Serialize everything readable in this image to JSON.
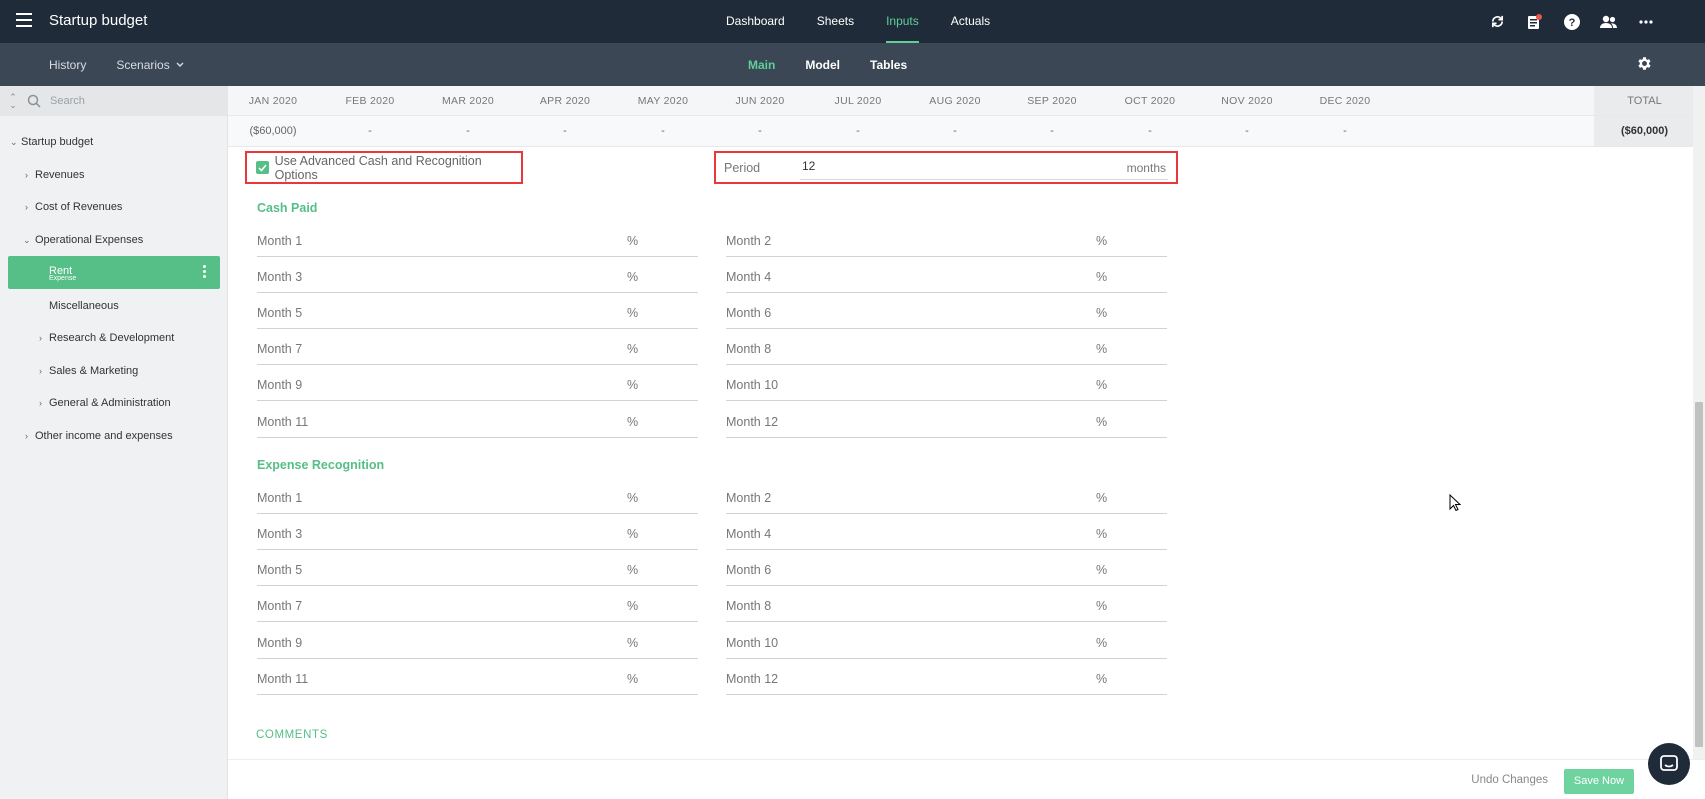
{
  "app": {
    "title": "Startup budget"
  },
  "topnav": [
    {
      "label": "Dashboard",
      "active": false
    },
    {
      "label": "Sheets",
      "active": false
    },
    {
      "label": "Inputs",
      "active": true
    },
    {
      "label": "Actuals",
      "active": false
    }
  ],
  "topicons": [
    "refresh-icon",
    "notifications-icon",
    "help-icon",
    "users-icon",
    "more-icon"
  ],
  "subbar": {
    "history_label": "History",
    "scenarios_label": "Scenarios",
    "tabs": [
      {
        "label": "Main",
        "active": true
      },
      {
        "label": "Model",
        "active": false
      },
      {
        "label": "Tables",
        "active": false
      }
    ]
  },
  "sidebar": {
    "search_placeholder": "Search",
    "items": [
      {
        "label": "Startup budget",
        "level": 0,
        "chevron": "down"
      },
      {
        "label": "Revenues",
        "level": 1,
        "chevron": "right"
      },
      {
        "label": "Cost of Revenues",
        "level": 1,
        "chevron": "right"
      },
      {
        "label": "Operational Expenses",
        "level": 1,
        "chevron": "down"
      },
      {
        "label": "Rent",
        "level": 2,
        "chevron": "",
        "active": true,
        "sublabel": "Expense"
      },
      {
        "label": "Miscellaneous",
        "level": 2,
        "chevron": ""
      },
      {
        "label": "Research & Development",
        "level": 2,
        "chevron": "right"
      },
      {
        "label": "Sales & Marketing",
        "level": 2,
        "chevron": "right"
      },
      {
        "label": "General & Administration",
        "level": 2,
        "chevron": "right"
      },
      {
        "label": "Other income and expenses",
        "level": 1,
        "chevron": "right"
      }
    ]
  },
  "months": {
    "headers": [
      "JAN 2020",
      "FEB 2020",
      "MAR 2020",
      "APR 2020",
      "MAY 2020",
      "JUN 2020",
      "JUL 2020",
      "AUG 2020",
      "SEP 2020",
      "OCT 2020",
      "NOV 2020",
      "DEC 2020"
    ],
    "values": [
      "($60,000)",
      "-",
      "-",
      "-",
      "-",
      "-",
      "-",
      "-",
      "-",
      "-",
      "-",
      "-"
    ],
    "total_header": "TOTAL",
    "total_value": "($60,000)"
  },
  "form": {
    "advanced_label": "Use Advanced Cash and Recognition Options",
    "advanced_checked": true,
    "period_label": "Period",
    "period_value": "12",
    "period_unit": "months",
    "cash_paid_title": "Cash Paid",
    "expense_recognition_title": "Expense Recognition",
    "month_labels": [
      "Month 1",
      "Month 2",
      "Month 3",
      "Month 4",
      "Month 5",
      "Month 6",
      "Month 7",
      "Month 8",
      "Month 9",
      "Month 10",
      "Month 11",
      "Month 12"
    ],
    "percent_symbol": "%",
    "comments_title": "COMMENTS"
  },
  "footer": {
    "undo_label": "Undo Changes",
    "save_label": "Save Now"
  },
  "colors": {
    "accent": "#56be87",
    "topbar": "#1f2b38",
    "subbar": "#3b4754",
    "highlight": "#e8383a"
  }
}
